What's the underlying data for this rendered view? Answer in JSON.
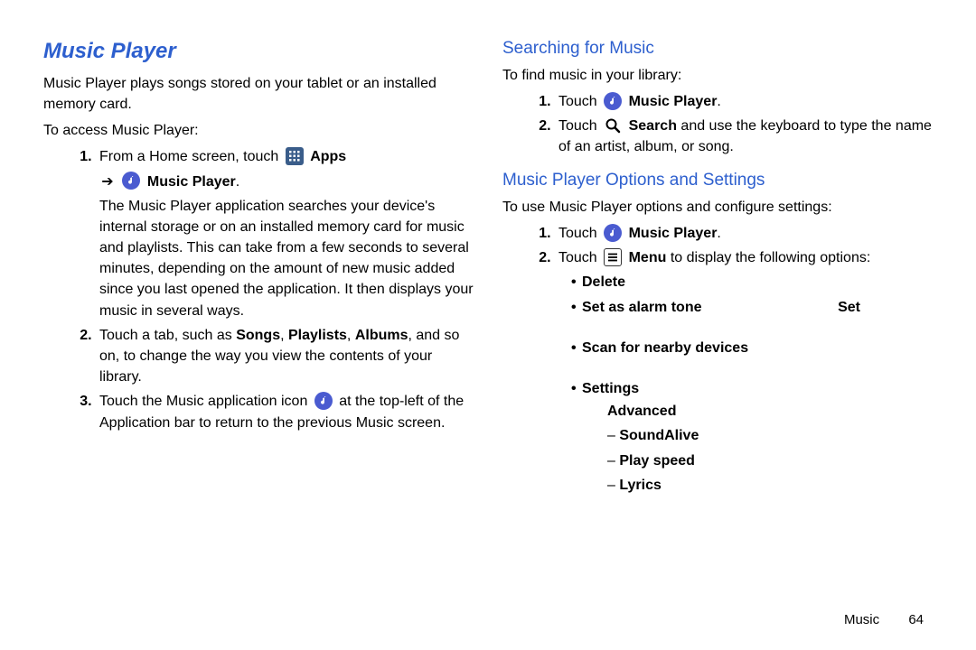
{
  "left": {
    "title": "Music Player",
    "intro": "Music Player plays songs stored on your tablet or an installed memory card.",
    "access_label": "To access Music Player:",
    "steps": {
      "s1_a": "From a Home screen, touch ",
      "s1_apps": "Apps",
      "arrow_text": "Music Player",
      "s1_desc": "The Music Player application searches your device's internal storage or on an installed memory card for music and playlists. This can take from a few seconds to several minutes, depending on the amount of new music added since you last opened the application. It then displays your music in several ways.",
      "s2_a": "Touch a tab, such as ",
      "s2_songs": "Songs",
      "s2_sep1": ", ",
      "s2_playlists": "Playlists",
      "s2_sep2": ", ",
      "s2_albums": "Albums",
      "s2_tail": ", and so on, to change the way you view the contents of your library.",
      "s3_a": "Touch the Music application icon ",
      "s3_tail": " at the top-left of the Application bar to return to the previous Music screen."
    }
  },
  "right": {
    "search_head": "Searching for Music",
    "search_intro": "To find music in your library:",
    "search_s1_a": "Touch ",
    "search_s1_b": "Music Player",
    "search_s2_a": "Touch ",
    "search_s2_b": "Search",
    "search_s2_tail": " and use the keyboard to type the name of an artist, album, or song.",
    "options_head": "Music Player Options and Settings",
    "options_intro": "To use Music Player options and configure settings:",
    "opt_s1_a": "Touch ",
    "opt_s1_b": "Music Player",
    "opt_s2_a": "Touch ",
    "opt_s2_b": "Menu",
    "opt_s2_tail": " to display the following options:",
    "bullets": {
      "delete": "Delete",
      "alarm": "Set as alarm tone",
      "set_right": "Set",
      "scan": "Scan for nearby devices",
      "settings": "Settings",
      "advanced": "Advanced",
      "d1": "SoundAlive",
      "d2": "Play speed",
      "d3": "Lyrics"
    }
  },
  "footer": {
    "section": "Music",
    "page": "64"
  }
}
